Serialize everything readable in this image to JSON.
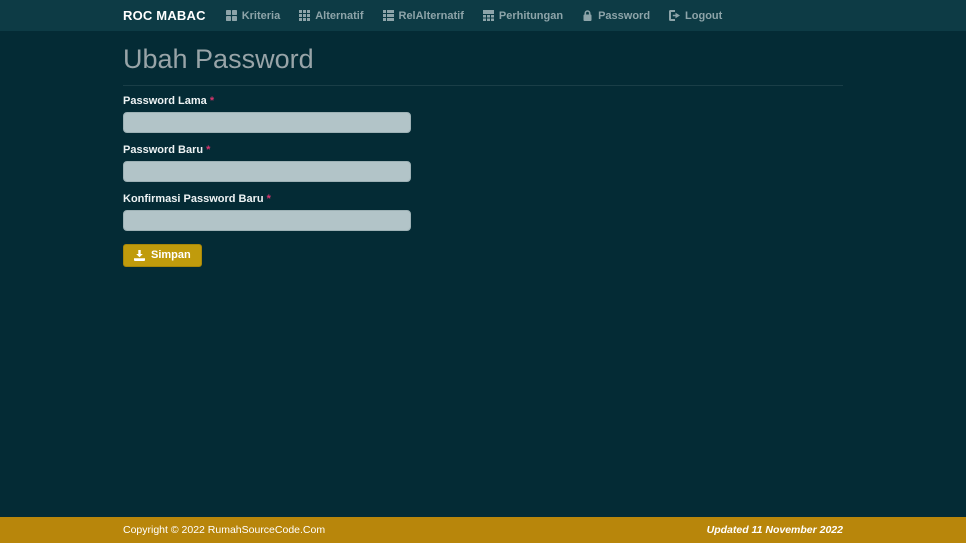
{
  "navbar": {
    "brand": "ROC MABAC",
    "items": [
      {
        "label": "Kriteria",
        "icon": "th-large-icon"
      },
      {
        "label": "Alternatif",
        "icon": "th-icon"
      },
      {
        "label": "RelAlternatif",
        "icon": "th-list-icon"
      },
      {
        "label": "Perhitungan",
        "icon": "table-icon"
      },
      {
        "label": "Password",
        "icon": "lock-icon"
      },
      {
        "label": "Logout",
        "icon": "sign-out-icon"
      }
    ]
  },
  "page": {
    "title": "Ubah Password"
  },
  "form": {
    "fields": [
      {
        "label": "Password Lama",
        "required_mark": "*",
        "value": "",
        "type": "password"
      },
      {
        "label": "Password Baru",
        "required_mark": "*",
        "value": "",
        "type": "password"
      },
      {
        "label": "Konfirmasi Password Baru",
        "required_mark": "*",
        "value": "",
        "type": "password"
      }
    ],
    "submit_label": "Simpan"
  },
  "footer": {
    "copyright": "Copyright © 2022 RumahSourceCode.Com",
    "updated": "Updated 11 November 2022"
  },
  "colors": {
    "navbar_bg": "#0d3b45",
    "body_bg": "#042b35",
    "footer_gold": "#b8860b",
    "button_gold": "#c09b0c",
    "input_bg": "#b2c4c8",
    "required_mark": "#d6356c",
    "heading_text": "#98a4a8",
    "nav_text": "#8da4a9"
  }
}
